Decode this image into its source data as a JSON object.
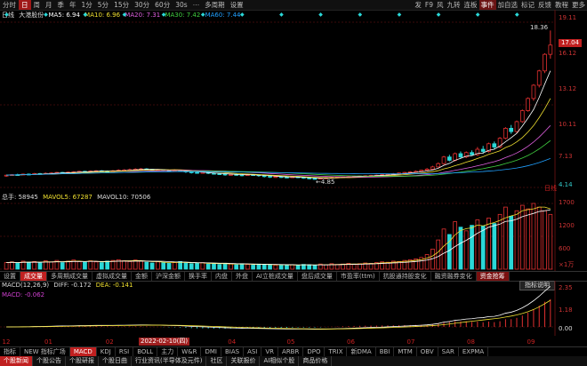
{
  "toolbar": {
    "left_items": [
      "分时",
      "日",
      "周",
      "月",
      "季",
      "年",
      "1分",
      "5分",
      "15分",
      "30分",
      "60分",
      "30s",
      "⋯",
      "多周期",
      "设置"
    ],
    "active_index": 1,
    "right_items": [
      "发",
      "F9",
      "风",
      "九转",
      "连板",
      "事件",
      "加自选",
      "标记",
      "反馈",
      "教程",
      "更多"
    ],
    "right_active_index": 5
  },
  "price_legend": {
    "period": "日线",
    "name": "大港股份",
    "ma5": "MA5: 6.94",
    "ma10": "MA10: 6.96",
    "ma20": "MA20: 7.31",
    "ma30": "MA30: 7.42",
    "ma60": "MA60: 7.44"
  },
  "price_axis": [
    "19.11",
    "16.12",
    "13.12",
    "10.11",
    "7.13",
    "4.14"
  ],
  "price_markers": {
    "high": "18.36",
    "last": "17.04",
    "low": "4.85"
  },
  "low_marker_icon": "arrow-left-icon",
  "volume_legend": {
    "name": "总手: 58945",
    "mavol5": "MAVOL5: 67287",
    "mavol10": "MAVOL10: 70506"
  },
  "volume_axis": [
    "1700",
    "1200",
    "600"
  ],
  "volume_unit": "×1万",
  "middle_tabs": [
    "设置",
    "成交量",
    "多周期成交量",
    "虚拟成交量",
    "金额",
    "沪深金额",
    "换手率",
    "内盘",
    "外盘",
    "AI立桩成交量",
    "盘后成交量",
    "市盈率(ttm)",
    "抗股通持股变化",
    "融资融券变化",
    "资金抢筹"
  ],
  "middle_active": 1,
  "middle_highlight": 14,
  "macd_legend": {
    "name": "MACD(12,26,9)",
    "diff": "DIFF: -0.172",
    "dea": "DEA: -0.141",
    "macd": "MACD: -0.062"
  },
  "macd_axis": [
    "2.35",
    "1.18",
    "0.00"
  ],
  "indicator_button": "指标说明",
  "date_axis": [
    "12",
    "01",
    "02",
    "03",
    "04",
    "05",
    "06",
    "07",
    "08",
    "09"
  ],
  "date_cursor": "2022-02-10(四)",
  "indicator_tabs": [
    "指标",
    "NEW 指标广场",
    "MACD",
    "KDJ",
    "RSI",
    "BOLL",
    "主力",
    "W&R",
    "DMI",
    "BIAS",
    "ASI",
    "VR",
    "ARBR",
    "DPO",
    "TRIX",
    "新DMA",
    "BBI",
    "MTM",
    "OBV",
    "SAR",
    "EXPMA"
  ],
  "indicator_active": 2,
  "bottom_tabs": [
    "个股新闻",
    "个股公告",
    "个股研报",
    "个股日曲",
    "行业资讯(半导体及元件)",
    "社区",
    "关联报价",
    "AI相似个股",
    "商品价格"
  ],
  "bottom_active": 0,
  "period_tag": "日线",
  "colors": {
    "up": "#e23030",
    "down": "#2ad8d8",
    "ma5": "#ffffff",
    "ma10": "#f0e030",
    "ma20": "#e060e0",
    "ma30": "#40d040",
    "ma60": "#20a0ff",
    "grid": "#3a0a0a"
  },
  "chart_data": {
    "type": "candlestick",
    "candles": [
      [
        5.2,
        5.25,
        5.1,
        5.3
      ],
      [
        5.25,
        5.3,
        5.2,
        5.35
      ],
      [
        5.3,
        5.28,
        5.2,
        5.38
      ],
      [
        5.28,
        5.35,
        5.25,
        5.4
      ],
      [
        5.35,
        5.32,
        5.25,
        5.4
      ],
      [
        5.32,
        5.4,
        5.3,
        5.45
      ],
      [
        5.4,
        5.38,
        5.3,
        5.45
      ],
      [
        5.38,
        5.42,
        5.35,
        5.5
      ],
      [
        5.42,
        5.45,
        5.38,
        5.52
      ],
      [
        5.45,
        5.5,
        5.4,
        5.55
      ],
      [
        5.5,
        5.48,
        5.42,
        5.55
      ],
      [
        5.48,
        5.52,
        5.45,
        5.58
      ],
      [
        5.52,
        5.55,
        5.48,
        5.62
      ],
      [
        5.55,
        5.6,
        5.5,
        5.65
      ],
      [
        5.6,
        5.58,
        5.5,
        5.65
      ],
      [
        5.58,
        5.62,
        5.55,
        5.68
      ],
      [
        5.62,
        5.65,
        5.58,
        5.7
      ],
      [
        5.65,
        5.62,
        5.55,
        5.7
      ],
      [
        5.62,
        5.6,
        5.52,
        5.68
      ],
      [
        5.6,
        5.65,
        5.55,
        5.72
      ],
      [
        5.65,
        5.7,
        5.6,
        5.78
      ],
      [
        5.7,
        5.72,
        5.65,
        5.8
      ],
      [
        5.72,
        5.75,
        5.68,
        5.85
      ],
      [
        5.75,
        5.8,
        5.7,
        5.88
      ],
      [
        5.8,
        5.82,
        5.75,
        5.9
      ],
      [
        5.82,
        5.78,
        5.72,
        5.88
      ],
      [
        5.78,
        5.72,
        5.65,
        5.8
      ],
      [
        5.72,
        5.75,
        5.68,
        5.8
      ],
      [
        5.75,
        5.7,
        5.62,
        5.78
      ],
      [
        5.7,
        5.68,
        5.6,
        5.75
      ],
      [
        5.68,
        5.72,
        5.62,
        5.78
      ],
      [
        5.72,
        5.65,
        5.6,
        5.75
      ],
      [
        5.65,
        5.55,
        5.45,
        5.68
      ],
      [
        5.55,
        5.5,
        5.4,
        5.6
      ],
      [
        5.5,
        5.45,
        5.38,
        5.55
      ],
      [
        5.45,
        5.5,
        5.4,
        5.55
      ],
      [
        5.5,
        5.42,
        5.35,
        5.55
      ],
      [
        5.42,
        5.38,
        5.3,
        5.48
      ],
      [
        5.38,
        5.35,
        5.28,
        5.42
      ],
      [
        5.35,
        5.3,
        5.2,
        5.4
      ],
      [
        5.3,
        5.32,
        5.22,
        5.38
      ],
      [
        5.32,
        5.28,
        5.2,
        5.38
      ],
      [
        5.28,
        5.25,
        5.15,
        5.32
      ],
      [
        5.25,
        5.3,
        5.2,
        5.35
      ],
      [
        5.3,
        5.28,
        5.2,
        5.35
      ],
      [
        5.28,
        5.2,
        5.1,
        5.3
      ],
      [
        5.2,
        5.15,
        5.05,
        5.25
      ],
      [
        5.15,
        5.1,
        5.0,
        5.2
      ],
      [
        5.1,
        5.12,
        5.02,
        5.18
      ],
      [
        5.12,
        5.08,
        5.0,
        5.18
      ],
      [
        5.08,
        5.05,
        4.98,
        5.12
      ],
      [
        5.05,
        5.1,
        5.0,
        5.15
      ],
      [
        5.1,
        5.06,
        4.98,
        5.14
      ],
      [
        5.06,
        5.0,
        4.92,
        5.1
      ],
      [
        5.0,
        4.95,
        4.88,
        5.04
      ],
      [
        4.95,
        4.92,
        4.85,
        5.0
      ],
      [
        4.92,
        4.98,
        4.88,
        5.02
      ],
      [
        4.98,
        5.02,
        4.95,
        5.08
      ],
      [
        5.02,
        5.05,
        4.98,
        5.1
      ],
      [
        5.05,
        5.08,
        5.0,
        5.12
      ],
      [
        5.08,
        5.1,
        5.02,
        5.15
      ],
      [
        5.1,
        5.12,
        5.05,
        5.18
      ],
      [
        5.12,
        5.15,
        5.08,
        5.2
      ],
      [
        5.15,
        5.18,
        5.1,
        5.22
      ],
      [
        5.18,
        5.2,
        5.12,
        5.25
      ],
      [
        5.2,
        5.22,
        5.15,
        5.28
      ],
      [
        5.22,
        5.25,
        5.18,
        5.3
      ],
      [
        5.25,
        5.3,
        5.2,
        5.35
      ],
      [
        5.3,
        5.35,
        5.25,
        5.4
      ],
      [
        5.35,
        5.38,
        5.3,
        5.45
      ],
      [
        5.38,
        5.45,
        5.35,
        5.5
      ],
      [
        5.45,
        5.5,
        5.4,
        5.55
      ],
      [
        5.5,
        5.55,
        5.45,
        5.62
      ],
      [
        5.55,
        5.6,
        5.5,
        5.68
      ],
      [
        5.6,
        5.7,
        5.55,
        5.75
      ],
      [
        5.7,
        5.8,
        5.65,
        5.9
      ],
      [
        5.8,
        6.0,
        5.75,
        6.1
      ],
      [
        6.0,
        6.3,
        5.95,
        6.4
      ],
      [
        6.3,
        6.9,
        6.2,
        7.0
      ],
      [
        6.9,
        6.6,
        6.5,
        7.1
      ],
      [
        6.6,
        7.2,
        6.5,
        7.3
      ],
      [
        7.2,
        6.9,
        6.8,
        7.4
      ],
      [
        6.9,
        7.3,
        6.8,
        7.4
      ],
      [
        7.3,
        7.1,
        7.0,
        7.5
      ],
      [
        7.1,
        7.6,
        7.0,
        7.8
      ],
      [
        7.6,
        7.4,
        7.2,
        7.9
      ],
      [
        7.4,
        8.1,
        7.3,
        8.2
      ],
      [
        8.1,
        7.8,
        7.6,
        8.3
      ],
      [
        7.8,
        8.6,
        7.7,
        8.7
      ],
      [
        8.6,
        9.5,
        8.5,
        9.6
      ],
      [
        9.5,
        9.2,
        9.0,
        9.8
      ],
      [
        9.2,
        10.1,
        9.1,
        10.2
      ],
      [
        10.1,
        11.1,
        10.0,
        11.2
      ],
      [
        11.1,
        12.2,
        11.0,
        12.3
      ],
      [
        12.2,
        13.4,
        12.0,
        13.5
      ],
      [
        13.4,
        14.7,
        13.2,
        14.8
      ],
      [
        14.7,
        16.2,
        14.5,
        16.3
      ],
      [
        16.2,
        17.04,
        15.8,
        18.36
      ]
    ],
    "volumes": [
      18,
      20,
      16,
      22,
      19,
      21,
      17,
      23,
      20,
      24,
      18,
      22,
      25,
      21,
      19,
      23,
      20,
      18,
      22,
      24,
      26,
      23,
      21,
      25,
      22,
      19,
      17,
      20,
      18,
      16,
      19,
      21,
      17,
      15,
      16,
      18,
      14,
      15,
      13,
      16,
      14,
      12,
      15,
      13,
      11,
      14,
      12,
      13,
      11,
      12,
      10,
      12,
      11,
      13,
      12,
      10,
      14,
      12,
      15,
      13,
      14,
      16,
      13,
      15,
      17,
      16,
      18,
      20,
      19,
      22,
      21,
      24,
      26,
      28,
      32,
      40,
      55,
      80,
      110,
      95,
      130,
      115,
      105,
      120,
      135,
      118,
      140,
      125,
      150,
      170,
      145,
      160,
      175,
      165,
      180,
      170,
      160,
      150
    ],
    "ylim": [
      4.14,
      19.11
    ]
  }
}
